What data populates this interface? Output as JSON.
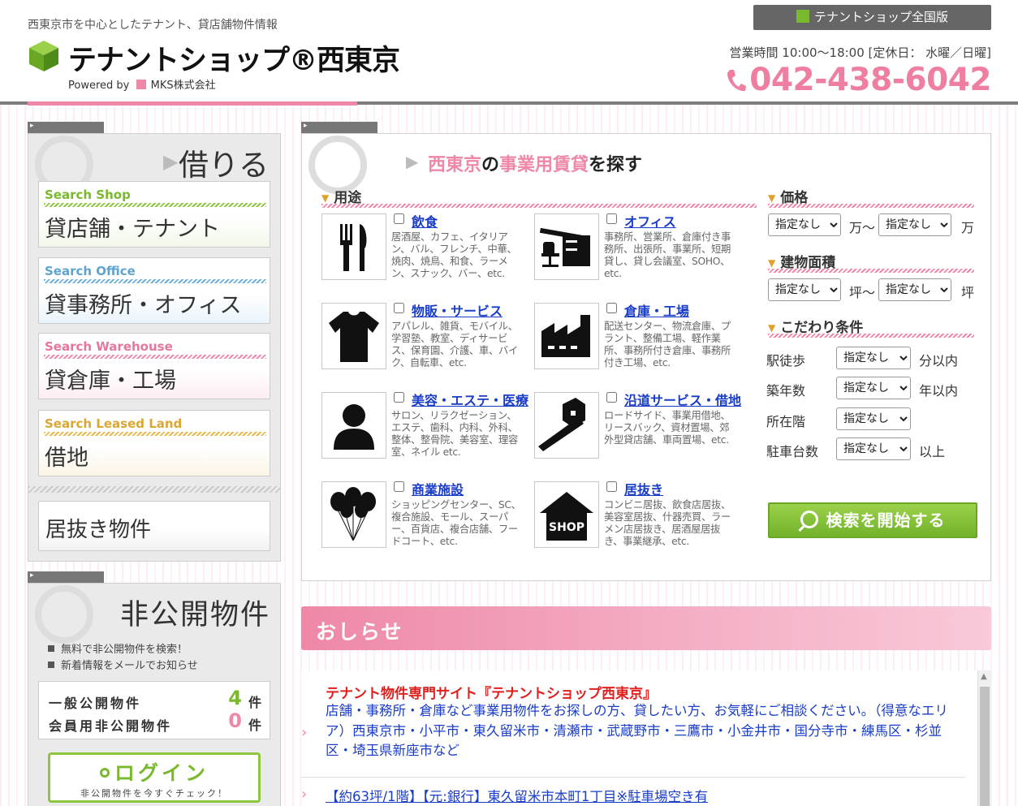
{
  "header": {
    "tagline": "西東京市を中心としたテナント、貸店舗物件情報",
    "logo_text": "テナントショップ®西東京",
    "powered_prefix": "Powered by",
    "powered_company": "MKS株式会社",
    "national_button": "テナントショップ全国版",
    "hours": "営業時間 10:00～18:00 [定休日： 水曜／日曜]",
    "phone": "042-438-6042"
  },
  "sidebar": {
    "rent_title": "借りる",
    "cards": [
      {
        "en": "Search Shop",
        "jp": "貸店舗・テナント"
      },
      {
        "en": "Search Office",
        "jp": "貸事務所・オフィス"
      },
      {
        "en": "Search Warehouse",
        "jp": "貸倉庫・工場"
      },
      {
        "en": "Search Leased Land",
        "jp": "借地"
      }
    ],
    "inuki": "居抜き物件",
    "private_title": "非公開物件",
    "bullets": [
      "無料で非公開物件を検索！",
      "新着情報をメールでお知らせ"
    ],
    "public_label": "一般公開物件",
    "public_count": "4",
    "member_label": "会員用非公開物件",
    "member_count": "0",
    "count_unit": "件",
    "login_label": "ログイン",
    "login_sub": "非公開物件を今すぐチェック！"
  },
  "search": {
    "title_a": "西東京",
    "title_b": "の",
    "title_c": "事業用賃貸",
    "title_d": "を探す",
    "usage_head": "用途",
    "categories": [
      {
        "name": "飲食",
        "desc": "居酒屋、カフェ、イタリアン、バル、フレンチ、中華、焼肉、焼鳥、和食、ラーメン、スナック、バー、etc."
      },
      {
        "name": "オフィス",
        "desc": "事務所、営業所、倉庫付き事務所、出張所、事業所、短期貸し、貸し会議室、SOHO、etc."
      },
      {
        "name": "物販・サービス",
        "desc": "アパレル、雑貨、モバイル、学習塾、教室、ディサービス、保育園、介護、車、バイク、自転車、etc."
      },
      {
        "name": "倉庫・工場",
        "desc": "配送センター、物流倉庫、プラント、整備工場、軽作業所、事務所付き倉庫、事務所付き工場、etc."
      },
      {
        "name": "美容・エステ・医療",
        "desc": "サロン、リラクゼーション、エステ、歯科、内科、外科、整体、整骨院、美容室、理容室、ネイル etc."
      },
      {
        "name": "沿道サービス・借地",
        "desc": "ロードサイド、事業用借地、リースバック、資材置場、郊外型貸店舗、車両置場、etc."
      },
      {
        "name": "商業施設",
        "desc": "ショッピングセンター、SC、複合施設、モール、スーパー、百貨店、複合店舗、フードコート、etc."
      },
      {
        "name": "居抜き",
        "desc": "コンビニ居抜、飲食店居抜、美容室居抜、什器売買、ラーメン店居抜き、居酒屋居抜き、事業継承、etc."
      }
    ],
    "shop_sign": "SHOP",
    "price_head": "価格",
    "area_head": "建物面積",
    "cond_head": "こだわり条件",
    "select_default": "指定なし",
    "price_unit_from": "万～",
    "price_unit_to": "万",
    "area_unit_from": "坪～",
    "area_unit_to": "坪",
    "conditions": [
      {
        "label": "駅徒歩",
        "unit": "分以内"
      },
      {
        "label": "築年数",
        "unit": "年以内"
      },
      {
        "label": "所在階",
        "unit": ""
      },
      {
        "label": "駐車台数",
        "unit": "以上"
      }
    ],
    "search_button": "検索を開始する"
  },
  "news": {
    "title": "おしらせ",
    "item1_head": "テナント物件専門サイト『テナントショップ西東京』",
    "item1_body": "店舗・事務所・倉庫など事業用物件をお探しの方、貸したい方、お気軽にご相談ください。（得意なエリア）西東京市・小平市・東久留米市・清瀬市・武蔵野市・三鷹市・小金井市・国分寺市・練馬区・杉並区・埼玉県新座市など",
    "item2": "【約63坪/1階】【元:銀行】東久留米市本町1丁目※駐車場空き有"
  },
  "colors": {
    "brand_pink": "#ee88a6",
    "brand_green": "#7ab82d",
    "link_blue": "#1a3dc8",
    "news_red": "#e0201e"
  }
}
